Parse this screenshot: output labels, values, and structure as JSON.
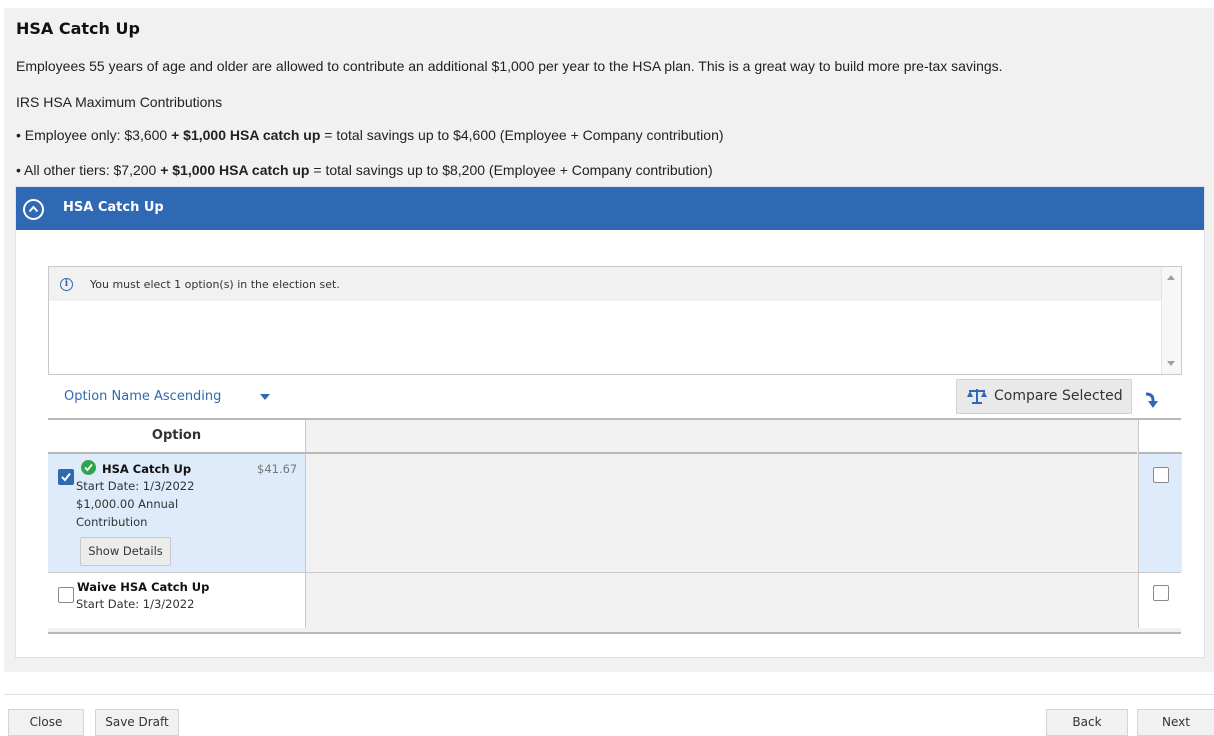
{
  "page": {
    "title": "HSA Catch Up",
    "intro": "Employees 55 years of age and older are allowed to contribute an additional $1,000 per year to the HSA plan. This is a great way to build more pre-tax savings.",
    "limits_heading": "IRS HSA Maximum Contributions",
    "line1": {
      "pre": "• Employee only: $3,600 ",
      "bold": "+ $1,000 HSA catch up",
      "post": " = total savings up to $4,600 (Employee + Company contribution)"
    },
    "line2": {
      "pre": "• All other tiers: $7,200 ",
      "bold": "+ $1,000 HSA catch up",
      "post": " = total savings up to $8,200 (Employee + Company contribution)"
    }
  },
  "section": {
    "title": "HSA Catch Up",
    "message": "You must elect 1 option(s) in the election set.",
    "sort_label": "Option Name Ascending",
    "compare_label": "Compare Selected",
    "column_header": "Option"
  },
  "options": [
    {
      "name": "HSA Catch Up",
      "price": "$41.67",
      "start_date": "Start Date: 1/3/2022",
      "amount": "$1,000.00 Annual",
      "amount2": "Contribution",
      "details_label": "Show Details",
      "selected": true
    },
    {
      "name": "Waive HSA Catch Up",
      "start_date": "Start Date: 1/3/2022",
      "selected": false
    }
  ],
  "footer": {
    "close": "Close",
    "save_draft": "Save Draft",
    "back": "Back",
    "next": "Next"
  },
  "colors": {
    "header_blue": "#2f68b3",
    "selected_row": "#deebfa",
    "check_green": "#2ea44f"
  },
  "icons": [
    "chevron-up-icon",
    "info-icon",
    "caret-down-icon",
    "scale-icon",
    "sort-direction-icon",
    "checkmark-icon"
  ]
}
